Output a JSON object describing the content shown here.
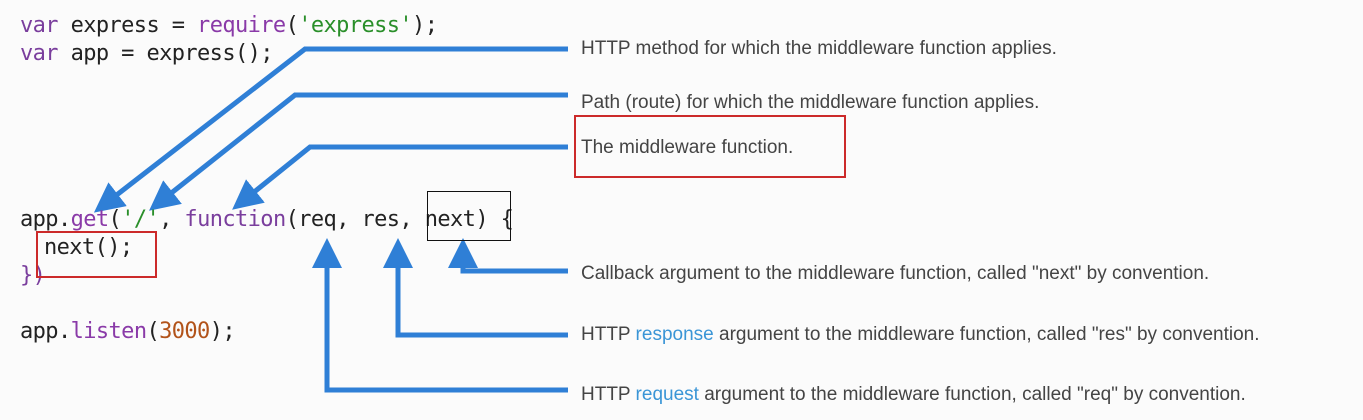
{
  "code": {
    "line1": {
      "kw": "var",
      "id": " express = ",
      "fn": "require",
      "open": "(",
      "str": "'express'",
      "close": ");"
    },
    "line2": {
      "kw": "var",
      "id": " app = express",
      "close": "();"
    },
    "line3": {
      "obj": "app",
      "dot": ".",
      "method": "get",
      "open": "(",
      "path": "'/'",
      "comma": ", ",
      "fnkw": "function",
      "p_open": "(",
      "req": "req",
      "sep1": ", ",
      "res": "res",
      "sep2": ", ",
      "next": "next",
      "p_close": ")",
      "brace": " {"
    },
    "line4": {
      "call": "next();"
    },
    "line5": {
      "close": "})"
    },
    "line6": {
      "obj": "app",
      "dot": ".",
      "method": "listen",
      "open": "(",
      "num": "3000",
      "close": ");"
    }
  },
  "annotations": {
    "method": "HTTP method for which the middleware function applies.",
    "path": "Path (route) for which the middleware function applies.",
    "middleware": "The middleware function.",
    "next": "Callback argument to the middleware function, called \"next\" by convention.",
    "res": {
      "prefix": "HTTP ",
      "highlight": "response",
      "suffix": " argument to the middleware function, called \"res\" by convention."
    },
    "req": {
      "prefix": "HTTP ",
      "highlight": "request",
      "suffix": " argument to the middleware function, called \"req\" by convention."
    }
  },
  "colors": {
    "arrow": "#2f7fd6",
    "highlight_box": "#cc2a2a",
    "link_text": "#3a95d6"
  }
}
